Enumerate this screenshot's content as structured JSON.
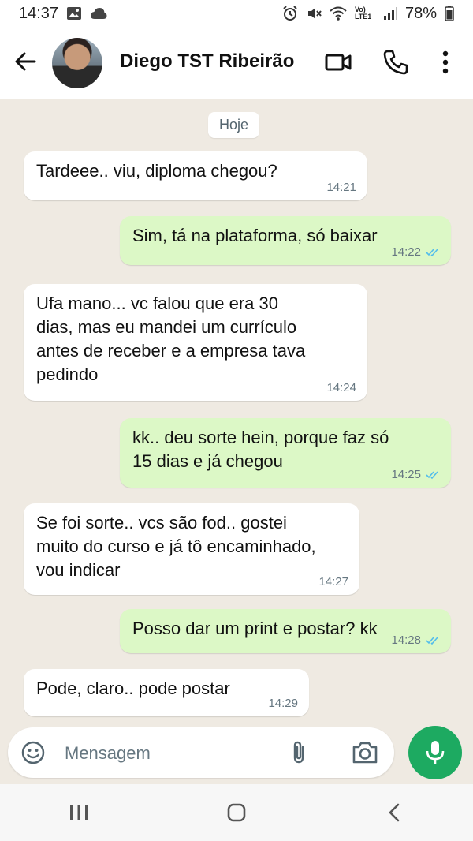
{
  "status_bar": {
    "time": "14:37",
    "network": "Vo) LTE1",
    "battery": "78%"
  },
  "header": {
    "contact_name": "Diego TST Ribeirão",
    "icons": [
      "back-arrow-icon",
      "video-call-icon",
      "voice-call-icon",
      "more-options-icon"
    ]
  },
  "chat": {
    "day_chip": "Hoje",
    "messages": [
      {
        "direction": "in",
        "text": "Tardeee.. viu, diploma chegou?",
        "time": "14:21"
      },
      {
        "direction": "out",
        "text": "Sim, tá na plataforma, só baixar",
        "time": "14:22",
        "read": true
      },
      {
        "direction": "in",
        "text": "Ufa mano... vc falou que era 30\ndias, mas eu mandei um currículo\nantes de receber e a empresa tava\npedindo",
        "time": "14:24"
      },
      {
        "direction": "out",
        "text": "kk.. deu sorte hein, porque faz só\n15 dias e já chegou",
        "time": "14:25",
        "read": true
      },
      {
        "direction": "in",
        "text": "Se foi sorte.. vcs são fod.. gostei\nmuito do curso e já tô encaminhado,\nvou indicar",
        "time": "14:27"
      },
      {
        "direction": "out",
        "text": "Posso dar um print e postar? kk",
        "time": "14:28",
        "read": true
      },
      {
        "direction": "in",
        "text": "Pode, claro.. pode postar",
        "time": "14:29"
      }
    ]
  },
  "composer": {
    "placeholder": "Mensagem"
  },
  "colors": {
    "incoming_bubble": "#ffffff",
    "outgoing_bubble": "#dcf8c6",
    "chat_background": "#efeae2",
    "mic_button": "#1daa61",
    "read_ticks": "#53bdeb"
  }
}
